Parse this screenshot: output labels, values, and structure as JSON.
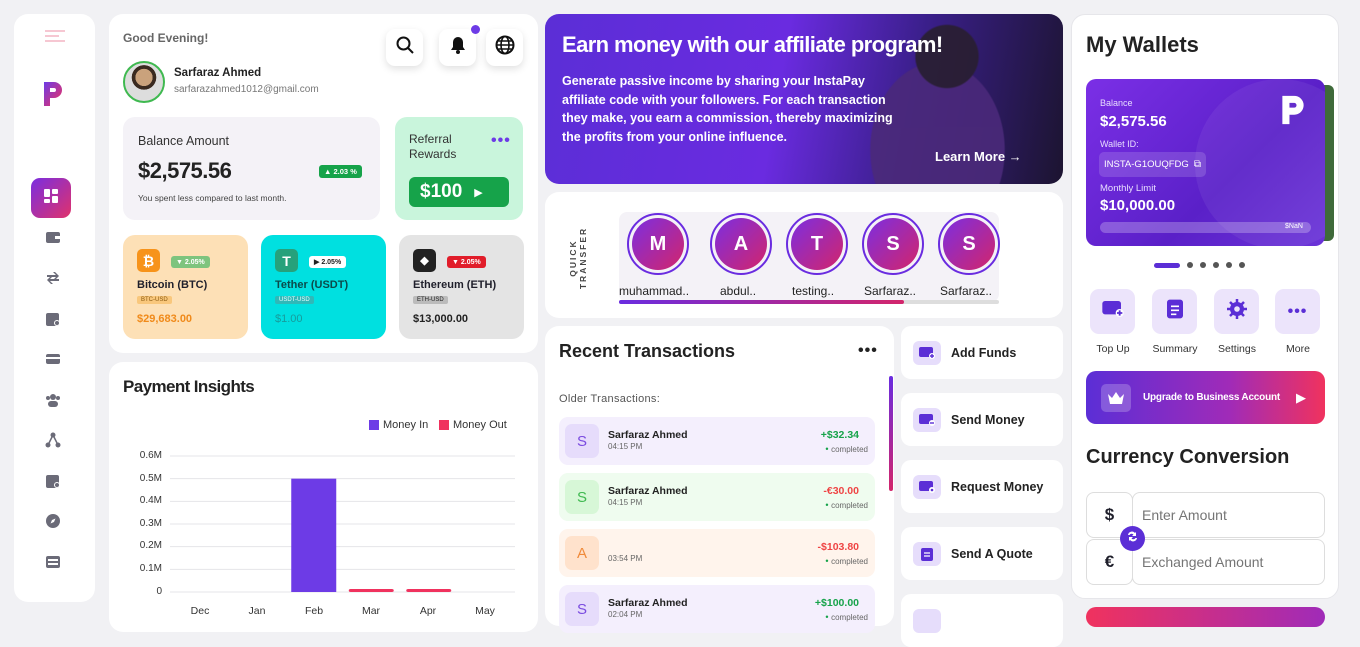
{
  "greeting": "Good Evening!",
  "user": {
    "name": "Sarfaraz Ahmed",
    "email": "sarfarazahmed1012@gmail.com"
  },
  "balance": {
    "label": "Balance Amount",
    "amount": "$2,575.56",
    "change": "▲ 2.03 %",
    "note": "You spent less compared to last month."
  },
  "referral": {
    "label_line1": "Referral",
    "label_line2": "Rewards",
    "amount": "$100"
  },
  "coins": [
    {
      "symbol": "₿",
      "change": "▼ 2.05%",
      "name": "Bitcoin (BTC)",
      "pair": "BTC-USD",
      "price": "$29,683.00"
    },
    {
      "symbol": "T",
      "change": "▶ 2.05%",
      "name": "Tether (USDT)",
      "pair": "USDT-USD",
      "price": "$1.00"
    },
    {
      "symbol": "◆",
      "change": "▼ 2.05%",
      "name": "Ethereum (ETH)",
      "pair": "ETH-USD",
      "price": "$13,000.00"
    }
  ],
  "insights": {
    "title": "Payment Insights",
    "legend_in": "Money In",
    "legend_out": "Money Out"
  },
  "chart_data": {
    "type": "bar",
    "title": "Payment Insights",
    "categories": [
      "Dec",
      "Jan",
      "Feb",
      "Mar",
      "Apr",
      "May"
    ],
    "yticks": [
      "0.6M",
      "0.5M",
      "0.4M",
      "0.3M",
      "0.2M",
      "0.1M",
      "0"
    ],
    "ylim": [
      0,
      0.6
    ],
    "grid": true,
    "legend": "top-right",
    "series": [
      {
        "name": "Money In",
        "color": "#6d3be6",
        "values": [
          0,
          0,
          0.5,
          0,
          0,
          0
        ]
      },
      {
        "name": "Money Out",
        "color": "#f0325e",
        "values": [
          0,
          0,
          0,
          0.003,
          0.01,
          0
        ]
      }
    ]
  },
  "banner": {
    "title": "Earn money with our affiliate program!",
    "text": "Generate passive income by sharing your InstaPay affiliate code with your followers. For each transaction they make, you earn a commission, thereby maximizing the profits from your online influence.",
    "cta": "Learn More →"
  },
  "quick_transfer": {
    "label": "QUICK TRANSFER",
    "contacts": [
      {
        "initial": "M",
        "name": "muhammad.."
      },
      {
        "initial": "A",
        "name": "abdul.."
      },
      {
        "initial": "T",
        "name": "testing.."
      },
      {
        "initial": "S",
        "name": "Sarfaraz.."
      },
      {
        "initial": "S",
        "name": "Sarfaraz.."
      }
    ]
  },
  "transactions": {
    "title": "Recent Transactions",
    "section": "Older Transactions:",
    "items": [
      {
        "initial": "S",
        "name": "Sarfaraz Ahmed",
        "time": "04:15 PM",
        "amount": "+$32.34",
        "status": "completed",
        "bg": "#f4effd",
        "avbg": "#e6dcfb",
        "avfg": "#7a4be0",
        "amtColor": "#16a34a"
      },
      {
        "initial": "S",
        "name": "Sarfaraz Ahmed",
        "time": "04:15 PM",
        "amount": "-€30.00",
        "status": "completed",
        "bg": "#effcef",
        "avbg": "#d7f7d7",
        "avfg": "#3fb950",
        "amtColor": "#ef4444"
      },
      {
        "initial": "A",
        "name": "",
        "time": "03:54 PM",
        "amount": "-$103.80",
        "status": "completed",
        "bg": "#fff4ec",
        "avbg": "#ffe2cc",
        "avfg": "#f08a3a",
        "amtColor": "#ef4444"
      },
      {
        "initial": "S",
        "name": "Sarfaraz Ahmed",
        "time": "02:04 PM",
        "amount": "+$100.00",
        "status": "completed",
        "bg": "#f4effd",
        "avbg": "#e6dcfb",
        "avfg": "#7a4be0",
        "amtColor": "#16a34a"
      }
    ]
  },
  "actions": [
    {
      "label": "Add Funds",
      "icon": "add-funds-icon"
    },
    {
      "label": "Send Money",
      "icon": "send-money-icon"
    },
    {
      "label": "Request Money",
      "icon": "request-money-icon"
    },
    {
      "label": "Send A Quote",
      "icon": "quote-icon"
    }
  ],
  "wallet": {
    "title": "My Wallets",
    "balance_label": "Balance",
    "balance": "$2,575.56",
    "id_label": "Wallet ID:",
    "id": "INSTA-G1OUQFDG",
    "limit_label": "Monthly Limit",
    "limit": "$10,000.00",
    "progress_text": "$NaN",
    "buttons": [
      "Top Up",
      "Summary",
      "Settings",
      "More"
    ],
    "upgrade": "Upgrade to Business Account"
  },
  "conversion": {
    "title": "Currency Conversion",
    "from_symbol": "$",
    "to_symbol": "€",
    "from_placeholder": "Enter Amount",
    "to_placeholder": "Exchanged Amount"
  },
  "colors": {
    "primary": "#6d3be6",
    "accent": "#f0325e",
    "green": "#16a34a",
    "cyan": "#00e0e0",
    "mint": "#c9f5dc",
    "peach": "#fde0b6"
  }
}
